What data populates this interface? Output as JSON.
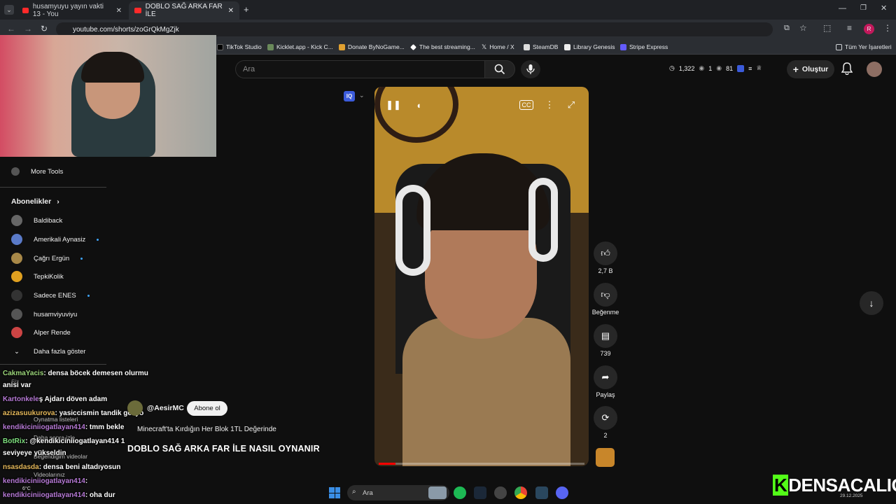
{
  "tabs": [
    {
      "label": "husamyuyu yayın vakti 13 - You"
    },
    {
      "label": "DOBLO SAĞ ARKA FAR İLE"
    }
  ],
  "address": "youtube.com/shorts/zoGrQkMgZjk",
  "bookmarks": [
    "TikTok Studio",
    "Kicklet.app - Kick C...",
    "Donate ByNoGame...",
    "The best streaming...",
    "Home / X",
    "SteamDB",
    "Library Genesis",
    "Stripe Express"
  ],
  "all_bookmarks": "Tüm Yer İşaretleri",
  "search": {
    "placeholder": "Ara"
  },
  "header_stats": {
    "a": "1,322",
    "b": "1",
    "c": "81"
  },
  "create_label": "Oluştur",
  "sidebar": {
    "more_tools": "More Tools",
    "subs_header": "Abonelikler",
    "subs": [
      {
        "name": "Baldiback",
        "new": false
      },
      {
        "name": "Amerikali Aynasiz",
        "new": true
      },
      {
        "name": "Çağrı Ergün",
        "new": true
      },
      {
        "name": "TepkiKolik",
        "new": false
      },
      {
        "name": "Sadece ENES",
        "new": true
      },
      {
        "name": "husamviyuviyu",
        "new": false
      },
      {
        "name": "Alper Rende",
        "new": false
      }
    ],
    "show_more": "Daha fazla göster",
    "hidden_items": [
      "Siz",
      "Oynatma listeleri",
      "Daha sonra izle",
      "Beğendiğim videolar",
      "Videolarınız"
    ]
  },
  "actions": {
    "likes": "2,7 B",
    "dislike": "Beğenme",
    "comments": "739",
    "share": "Paylaş",
    "remix": "2"
  },
  "video": {
    "channel": "@AesirMC",
    "subscribe": "Abone ol",
    "subtitle": "Minecraft'ta Kırdığın Her Blok 1TL Değerinde",
    "title": "DOBLO SAĞ ARKA FAR İLE NASIL OYNANIR",
    "progress": 0.08
  },
  "chat": [
    {
      "user": "CakmaYacis",
      "msg": ": densa böcek demesen olurmu",
      "cls": "u1"
    },
    {
      "user": "",
      "msg": "anisi var",
      "cls": ""
    },
    {
      "user": "Kartonkele",
      "msg": "ş Ajdarı döven adam",
      "cls": "u4"
    },
    {
      "user": "azizasuukurova",
      "msg": ": yasiccismin tandik geliyo",
      "cls": "u3"
    },
    {
      "user": "kendikiciniiogatlayan414",
      "msg": ": tmm bekle",
      "cls": "u4"
    },
    {
      "user": "BotRix",
      "msg": ": @kendikiciniiogatlayan414 1",
      "cls": "u5"
    },
    {
      "user": "",
      "msg": "seviyeye yükseldin",
      "cls": ""
    },
    {
      "user": "nsasdasda",
      "msg": ": densa beni altadıyosun",
      "cls": "u3"
    },
    {
      "user": "kendikiciniiogatlayan414",
      "msg": ":",
      "cls": "u4"
    },
    {
      "user": "kendikiciniiogatlayan414",
      "msg": ": oha dur",
      "cls": "u4"
    }
  ],
  "taskbar": {
    "search": "Ara",
    "weather": "6°C",
    "date": "29.12.2025"
  },
  "brand": {
    "k": "K",
    "name": "DENSACALIGO"
  }
}
